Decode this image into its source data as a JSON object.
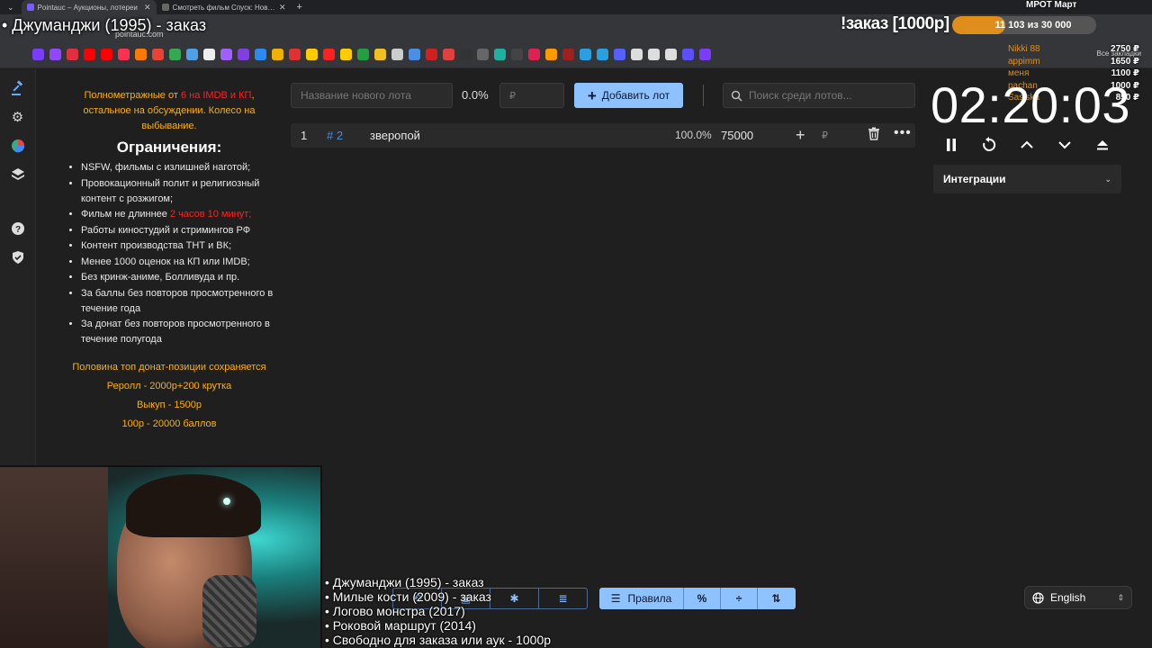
{
  "browser": {
    "tabs": [
      {
        "title": "Pointauc – Аукционы, лотереи",
        "active": true
      },
      {
        "title": "Смотреть фильм Спуск: Новая",
        "active": false
      }
    ],
    "url": "pointauc.com",
    "bookmarks_folder": "Все закладки"
  },
  "overlay": {
    "stream_title": "• Джуманджи (1995) - заказ",
    "order_title": "!заказ [1000р]",
    "goal_label": "МРОТ Март",
    "goal_progress_text": "11 103  из 30 000",
    "goal_fraction": 0.37,
    "donors": [
      "Nikki 88",
      "appimm",
      "меня",
      "pachan",
      "Sasiska"
    ],
    "donor_amounts": [
      "2750 ₽",
      "1650 ₽",
      "1100 ₽",
      "1000 ₽",
      "850 ₽"
    ]
  },
  "sidebar": {
    "icons": [
      "gavel-icon",
      "gear-icon",
      "wheel-icon",
      "layers-icon",
      "help-icon",
      "shield-icon"
    ]
  },
  "rules": {
    "intro_a": "Полнометражные от ",
    "intro_red": "6 на IMDB и КП",
    "intro_b": ", остальное на обсуждении. Колесо на выбывание.",
    "heading": "Ограничения:",
    "items": [
      "NSFW, фильмы с излишней наготой;",
      "Провокационный полит и религиозный контент с розжигом;",
      "Фильм не длиннее ",
      "Работы киностудий и стримингов РФ",
      "Контент производства ТНТ и ВК;",
      "Менее 1000 оценок на КП или IMDB;",
      "Без кринж-аниме, Болливуда и пр.",
      "За баллы без повторов просмотренного в течение года",
      "За донат без повторов просмотренного в течение полугода"
    ],
    "item3_red": "2 часов 10 минут;",
    "footer": [
      "Половина топ донат-позиции сохраняется",
      "Реролл - 2000р+200 крутка",
      "Выкуп - 1500р",
      "100р - 20000 баллов"
    ]
  },
  "controls": {
    "lot_name_placeholder": "Название нового лота",
    "percent": "0.0%",
    "currency_placeholder": "₽",
    "add_button": "Добавить лот",
    "search_placeholder": "Поиск среди лотов..."
  },
  "lots": [
    {
      "num": "1",
      "fast_id": "# 2",
      "name": "зверопой",
      "percent": "100.0%",
      "amount": "75000",
      "currency": "₽"
    }
  ],
  "timer": {
    "value": "02:20:03",
    "integrations_label": "Интеграции"
  },
  "movies": [
    "• Джуманджи (1995) - заказ",
    "• Милые кости (2009) - заказ",
    "• Логово монстра (2017)",
    "• Роковой маршрут (2014)",
    "• Свободно для заказа или аук - 1000р"
  ],
  "toolbar": {
    "rules_button": "Правила",
    "language": "English"
  },
  "colors": {
    "accent_blue": "#8ec2ff",
    "gold": "#ffb000",
    "red": "#ff2020",
    "progress_orange": "#e08e1b"
  }
}
